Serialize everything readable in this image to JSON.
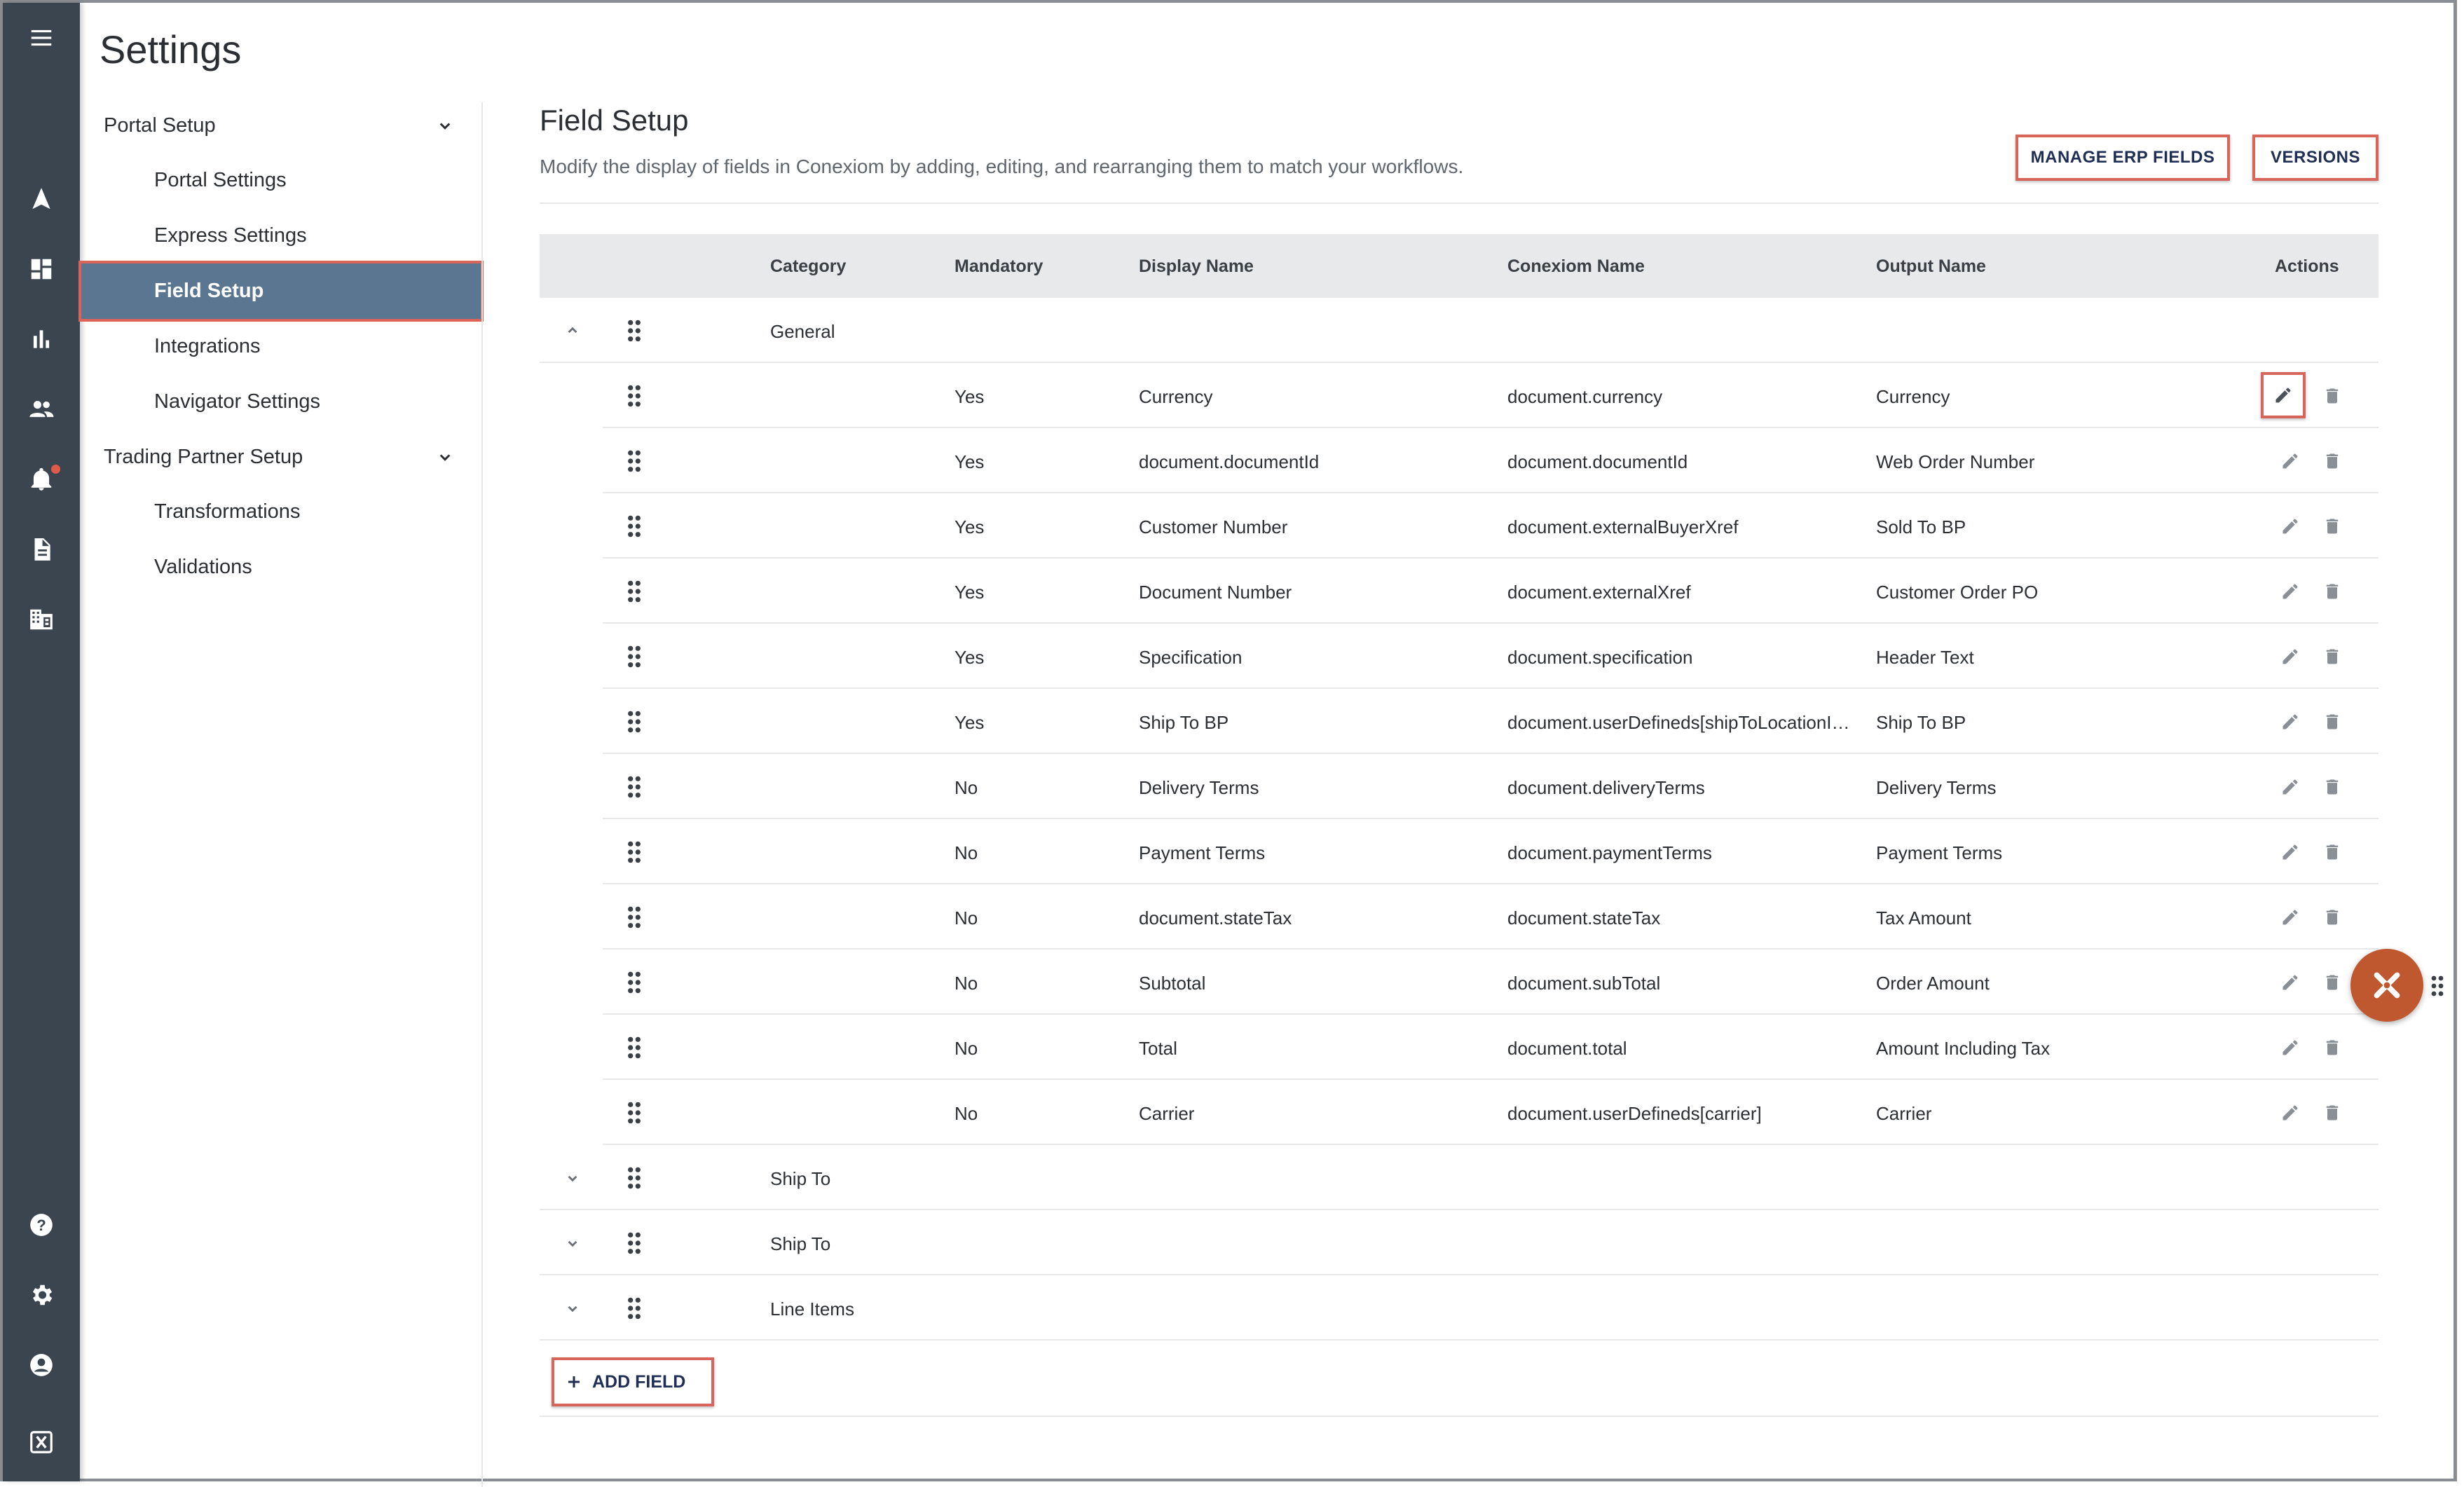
{
  "page": {
    "title": "Settings"
  },
  "rail": {
    "icons": [
      "menu-icon",
      "navigator-icon",
      "dashboard-icon",
      "analytics-icon",
      "users-icon",
      "notifications-icon",
      "documents-icon",
      "company-icon",
      "help-icon",
      "settings-icon",
      "account-icon",
      "conexiom-logo-icon"
    ],
    "notification_color": "#e05a4a"
  },
  "nav": {
    "sections": [
      {
        "label": "Portal Setup",
        "items": [
          "Portal Settings",
          "Express Settings",
          "Field Setup",
          "Integrations",
          "Navigator Settings"
        ]
      },
      {
        "label": "Trading Partner Setup",
        "items": [
          "Transformations",
          "Validations"
        ]
      }
    ],
    "active_item": "Field Setup"
  },
  "main": {
    "title": "Field Setup",
    "description": "Modify the display of fields in Conexiom by adding, editing, and rearranging them to match your workflows.",
    "buttons": {
      "manage_erp": "MANAGE ERP FIELDS",
      "versions": "VERSIONS"
    },
    "add_field": "ADD FIELD"
  },
  "table": {
    "headers": [
      "Category",
      "Mandatory",
      "Display Name",
      "Conexiom Name",
      "Output Name",
      "Actions"
    ],
    "groups": [
      {
        "category": "General",
        "expanded": true
      },
      {
        "category": "Ship To",
        "expanded": false
      },
      {
        "category": "Ship To",
        "expanded": false
      },
      {
        "category": "Line Items",
        "expanded": false
      }
    ],
    "rows": [
      {
        "mandatory": "Yes",
        "display": "Currency",
        "conexiom": "document.currency",
        "output": "Currency"
      },
      {
        "mandatory": "Yes",
        "display": "document.documentId",
        "conexiom": "document.documentId",
        "output": "Web Order Number"
      },
      {
        "mandatory": "Yes",
        "display": "Customer Number",
        "conexiom": "document.externalBuyerXref",
        "output": "Sold To BP"
      },
      {
        "mandatory": "Yes",
        "display": "Document Number",
        "conexiom": "document.externalXref",
        "output": "Customer Order PO"
      },
      {
        "mandatory": "Yes",
        "display": "Specification",
        "conexiom": "document.specification",
        "output": "Header Text"
      },
      {
        "mandatory": "Yes",
        "display": "Ship To BP",
        "conexiom": "document.userDefineds[shipToLocationI…",
        "output": "Ship To BP"
      },
      {
        "mandatory": "No",
        "display": "Delivery Terms",
        "conexiom": "document.deliveryTerms",
        "output": "Delivery Terms"
      },
      {
        "mandatory": "No",
        "display": "Payment Terms",
        "conexiom": "document.paymentTerms",
        "output": "Payment Terms"
      },
      {
        "mandatory": "No",
        "display": "document.stateTax",
        "conexiom": "document.stateTax",
        "output": "Tax Amount"
      },
      {
        "mandatory": "No",
        "display": "Subtotal",
        "conexiom": "document.subTotal",
        "output": "Order Amount"
      },
      {
        "mandatory": "No",
        "display": "Total",
        "conexiom": "document.total",
        "output": "Amount Including Tax"
      },
      {
        "mandatory": "No",
        "display": "Carrier",
        "conexiom": "document.userDefineds[carrier]",
        "output": "Carrier"
      }
    ]
  },
  "colors": {
    "rail": "#3b4550",
    "active_nav": "#5b7690",
    "highlight": "#d9655a",
    "fab": "#c0582f",
    "header_bg": "#e8e9eb"
  }
}
